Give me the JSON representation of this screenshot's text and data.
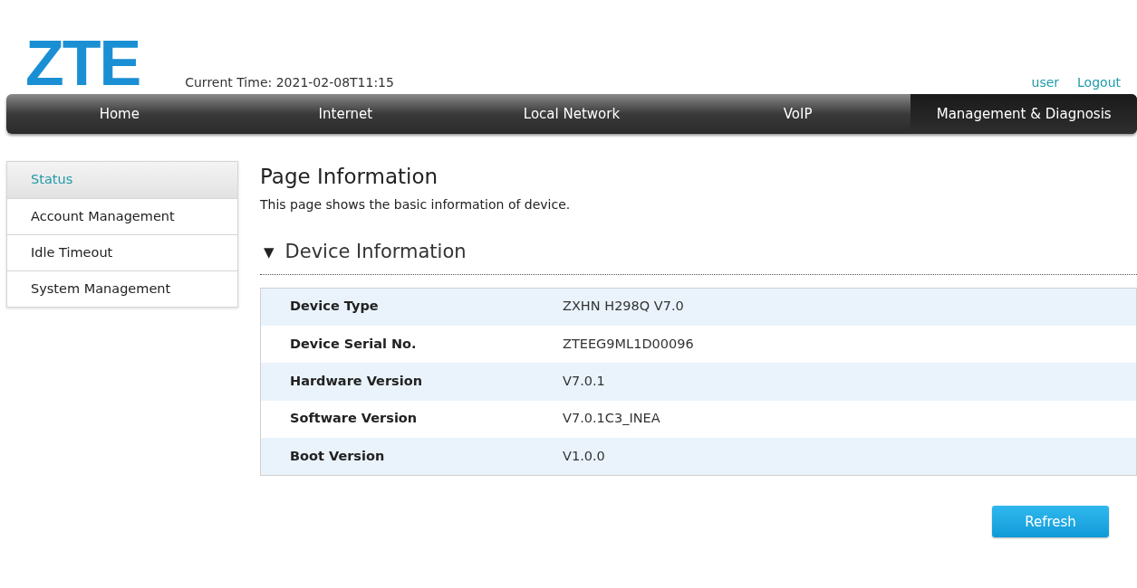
{
  "logo": "ZTE",
  "current_time": "Current Time: 2021-02-08T11:15",
  "user_links": [
    "user",
    "Logout"
  ],
  "nav": [
    {
      "label": "Home",
      "selected": false
    },
    {
      "label": "Internet",
      "selected": false
    },
    {
      "label": "Local Network",
      "selected": false
    },
    {
      "label": "VoIP",
      "selected": false
    },
    {
      "label": "Management & Diagnosis",
      "selected": true
    }
  ],
  "sidebar": {
    "items": [
      {
        "label": "Status",
        "selected": true
      },
      {
        "label": "Account Management",
        "selected": false
      },
      {
        "label": "Idle Timeout",
        "selected": false
      },
      {
        "label": "System Management",
        "selected": false
      }
    ]
  },
  "page": {
    "title": "Page Information",
    "description": "This page shows the basic information of device.",
    "section": {
      "toggle": "▼",
      "title": "Device Information",
      "expanded": true,
      "rows": [
        {
          "label": "Device Type",
          "value": "ZXHN H298Q V7.0"
        },
        {
          "label": "Device Serial No.",
          "value": "ZTEEG9ML1D00096"
        },
        {
          "label": "Hardware Version",
          "value": "V7.0.1"
        },
        {
          "label": "Software Version",
          "value": "V7.0.1C3_INEA"
        },
        {
          "label": "Boot Version",
          "value": "V1.0.0"
        }
      ]
    }
  },
  "buttons": [
    "Refresh"
  ]
}
